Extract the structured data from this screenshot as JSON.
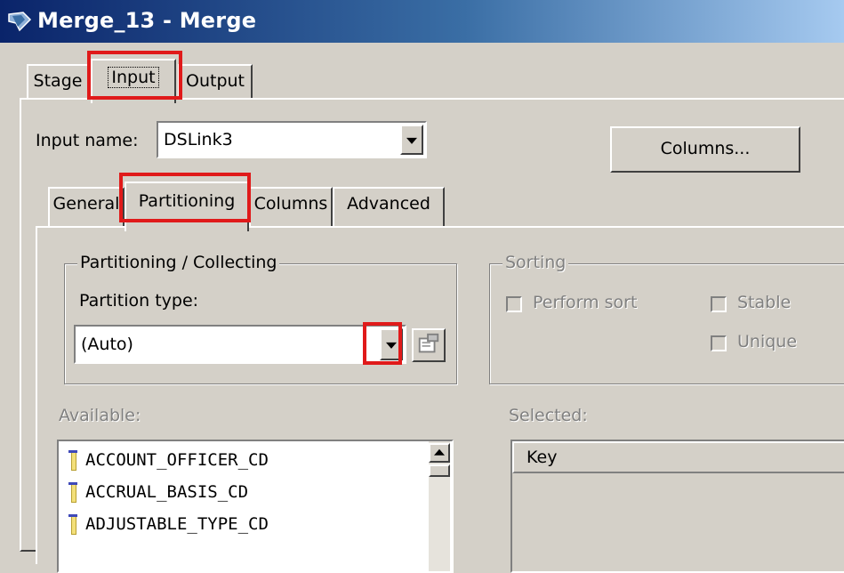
{
  "window": {
    "title": "Merge_13 - Merge"
  },
  "stage_tabs": [
    {
      "label": "Stage",
      "selected": false
    },
    {
      "label": "Input",
      "selected": true
    },
    {
      "label": "Output",
      "selected": false
    }
  ],
  "input": {
    "name_label": "Input name:",
    "name_value": "DSLink3",
    "columns_button": "Columns..."
  },
  "sub_tabs": [
    {
      "label": "General",
      "selected": false
    },
    {
      "label": "Partitioning",
      "selected": true
    },
    {
      "label": "Columns",
      "selected": false
    },
    {
      "label": "Advanced",
      "selected": false
    }
  ],
  "partitioning": {
    "group_title": "Partitioning / Collecting",
    "type_label": "Partition type:",
    "type_value": "(Auto)"
  },
  "sorting": {
    "group_title": "Sorting",
    "perform_sort": "Perform sort",
    "stable": "Stable",
    "unique": "Unique"
  },
  "available": {
    "label": "Available:",
    "items": [
      "ACCOUNT_OFFICER_CD",
      "ACCRUAL_BASIS_CD",
      "ADJUSTABLE_TYPE_CD"
    ]
  },
  "selected": {
    "label": "Selected:",
    "header": "Key"
  },
  "icons": {
    "window": "app-icon",
    "dropdown": "chevron-down-icon",
    "properties": "properties-icon",
    "column": "column-icon",
    "scroll_up": "scroll-up-icon"
  },
  "colors": {
    "title_bar_start": "#0a246a",
    "title_bar_end": "#a6caf0",
    "face": "#d4d0c8",
    "highlight": "#e01a1a",
    "disabled_text": "#808080"
  }
}
